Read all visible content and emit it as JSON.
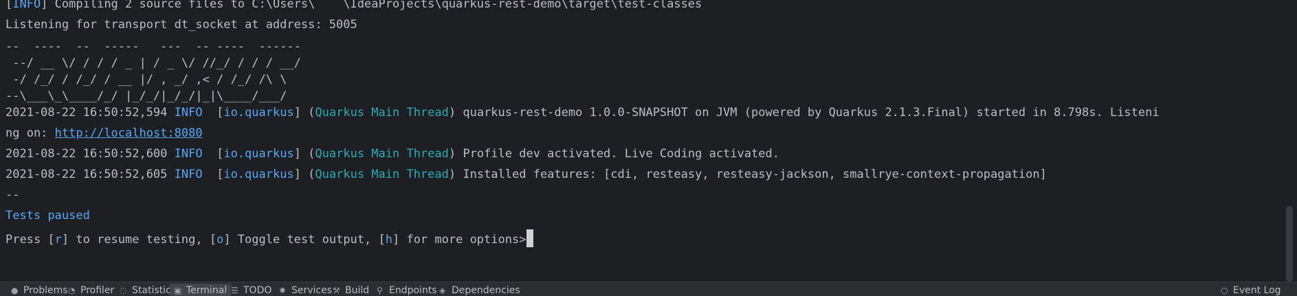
{
  "terminal": {
    "line1": {
      "bracket_open": "[",
      "level": "INFO",
      "rest": "] Compiling 2 source files to C:\\Users\\    \\IdeaProjects\\quarkus-rest-demo\\target\\test-classes"
    },
    "line2": "Listening for transport dt_socket at address: 5005",
    "banner": [
      "--  ----  --  -----   ---  -- ----  ------",
      " --/ __ \\/ / / / _ | / _ \\/ //_/ / / / __/",
      " -/ /_/ / /_/ / __ |/ , _/ ,< / /_/ /\\ \\  ",
      "--\\___\\_\\____/_/ |_/_/|_/_/|_|\\____/___/  "
    ],
    "log1": {
      "timestamp": "2021-08-22 16:50:52,594",
      "level": "INFO",
      "logger_open": "  [",
      "logger": "io.quarkus",
      "logger_close": "] (",
      "thread": "Quarkus Main Thread",
      "thread_close": ") ",
      "message": "quarkus-rest-demo 1.0.0-SNAPSHOT on JVM (powered by Quarkus 2.1.3.Final) started in 8.798s. Listeni",
      "message_cont": "ng on: ",
      "url": "http://localhost:8080"
    },
    "log2": {
      "timestamp": "2021-08-22 16:50:52,600",
      "level": "INFO",
      "logger_open": "  [",
      "logger": "io.quarkus",
      "logger_close": "] (",
      "thread": "Quarkus Main Thread",
      "thread_close": ") ",
      "message": "Profile dev activated. Live Coding activated."
    },
    "log3": {
      "timestamp": "2021-08-22 16:50:52,605",
      "level": "INFO",
      "logger_open": "  [",
      "logger": "io.quarkus",
      "logger_close": "] (",
      "thread": "Quarkus Main Thread",
      "thread_close": ") ",
      "message": "Installed features: [cdi, resteasy, resteasy-jackson, smallrye-context-propagation]"
    },
    "separator": "--",
    "tests_paused": "Tests paused",
    "prompt": {
      "p1": "Press [",
      "k1": "r",
      "p2": "] to resume testing, [",
      "k2": "o",
      "p3": "] Toggle test output, [",
      "k3": "h",
      "p4": "] for more options>"
    }
  },
  "toolbar": {
    "problems": "Problems",
    "profiler": "Profiler",
    "statistic": "Statistic",
    "terminal": "Terminal",
    "todo": "TODO",
    "services": "Services",
    "build": "Build",
    "endpoints": "Endpoints",
    "dependencies": "Dependencies",
    "event_log": "Event Log"
  },
  "colors": {
    "background": "#1e1f22",
    "text": "#bcbec4",
    "info_blue": "#56a8f5",
    "thread_teal": "#2aacb8"
  }
}
